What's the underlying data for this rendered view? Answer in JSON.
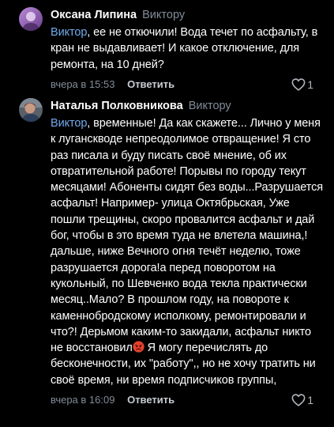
{
  "colors": {
    "background": "#000000",
    "mention": "#71aaeb",
    "secondary": "#818c99"
  },
  "comments": [
    {
      "author": "Оксана Липина",
      "reply_to": "Виктору",
      "mention": "Виктор",
      "text": ", ее не откючили! Вода течет по асфальту, в кран не выдавливает! И какое отключение, для ремонта, на 10 дней?",
      "time": "вчера в 15:53",
      "reply_label": "Ответить",
      "likes": "1",
      "avatar_icon": "avatar-purple-image"
    },
    {
      "author": "Наталья Полковникова",
      "reply_to": "Виктору",
      "mention": "Виктор",
      "text_part1": ", временные! Да как скажете... Лично у меня к луганскводе непреодолимое отвращение! Я сто раз писала и буду писать своё мнение, об их отвратительной работе! Порывы по городу текут месяцами! Абоненты сидят без воды...Разрушается асфальт! Например- улица Октябрьская, Уже пошли трещины, скоро провалится асфальт и дай бог, чтобы в это время туда не влетела машина,! дальше, ниже Вечного огня течёт неделю, тоже разрушается дорога!а перед поворотом на кукольный, по Шевченко вода текла практически месяц..Мало? В прошлом году, на повороте к каменнобродскому исполкому, ремонтировали и что?! Дерьмом каким-то закидали, асфальт никто не восстановил",
      "emoji_icon": "angry-face-emoji",
      "text_part2": " Я могу перечислять до бесконечности, их \"работу\",, но не хочу тратить ни своё время, ни время подписчиков группы,",
      "time": "вчера в 16:09",
      "reply_label": "Ответить",
      "likes": "1",
      "avatar_icon": "avatar-photo-image"
    }
  ]
}
